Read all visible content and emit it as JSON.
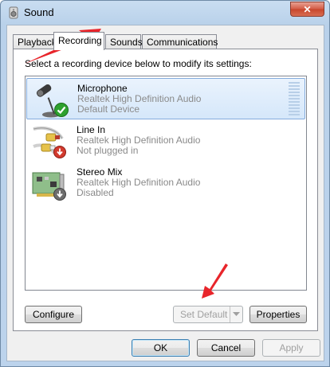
{
  "window": {
    "title": "Sound",
    "close_symbol": "✕"
  },
  "tabs": [
    {
      "label": "Playback",
      "active": false
    },
    {
      "label": "Recording",
      "active": true
    },
    {
      "label": "Sounds",
      "active": false
    },
    {
      "label": "Communications",
      "active": false
    }
  ],
  "panel": {
    "instruction": "Select a recording device below to modify its settings:"
  },
  "devices": [
    {
      "name": "Microphone",
      "driver": "Realtek High Definition Audio",
      "status": "Default Device",
      "icon": "microphone-icon",
      "badge": "green-check",
      "selected": true
    },
    {
      "name": "Line In",
      "driver": "Realtek High Definition Audio",
      "status": "Not plugged in",
      "icon": "line-in-cable-icon",
      "badge": "red-down-arrow",
      "selected": false
    },
    {
      "name": "Stereo Mix",
      "driver": "Realtek High Definition Audio",
      "status": "Disabled",
      "icon": "sound-card-icon",
      "badge": "gray-down-arrow",
      "selected": false
    }
  ],
  "panel_buttons": {
    "configure": "Configure",
    "set_default": "Set Default",
    "properties": "Properties"
  },
  "dialog_buttons": {
    "ok": "OK",
    "cancel": "Cancel",
    "apply": "Apply"
  },
  "colors": {
    "annotation_arrow": "#e8252b",
    "selection_border": "#84acdd",
    "check_badge": "#2ea12e"
  }
}
